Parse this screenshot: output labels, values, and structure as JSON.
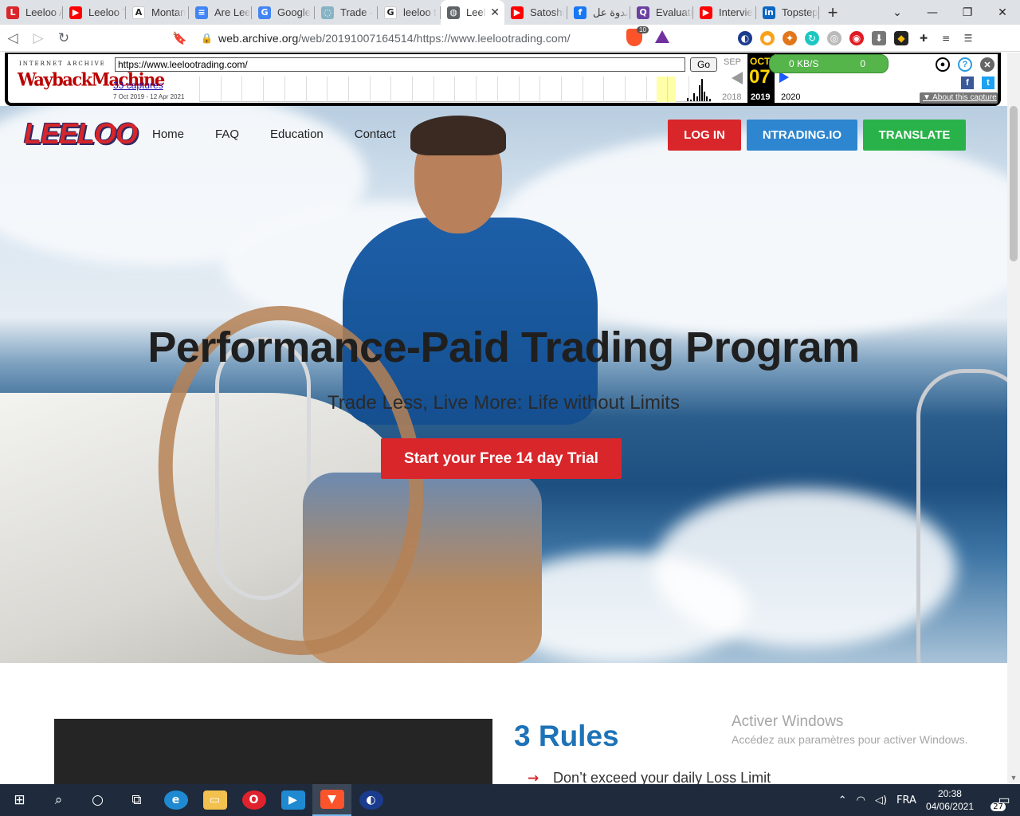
{
  "browser": {
    "tabs": [
      {
        "title": "Leeloo A",
        "icon": "leeloo-favicon",
        "color": "#d9262b",
        "glyph": "L"
      },
      {
        "title": "Leeloo T",
        "icon": "youtube-favicon",
        "color": "#ff0000",
        "glyph": "▶"
      },
      {
        "title": "Montan",
        "icon": "a-favicon",
        "color": "#ffffff",
        "glyph": "A"
      },
      {
        "title": "Are Lee",
        "icon": "google-docs-favicon",
        "color": "#4285f4",
        "glyph": "≡"
      },
      {
        "title": "Google",
        "icon": "google-translate-favicon",
        "color": "#4285f4",
        "glyph": "G"
      },
      {
        "title": "Trade -",
        "icon": "loading-favicon",
        "color": "#86b4c4",
        "glyph": "◌"
      },
      {
        "title": "leeloo t",
        "icon": "google-favicon",
        "color": "#ffffff",
        "glyph": "G"
      },
      {
        "title": "Leel",
        "icon": "globe-favicon",
        "color": "#5f6368",
        "glyph": "◍",
        "active": true
      },
      {
        "title": "Satoshi",
        "icon": "youtube-favicon",
        "color": "#ff0000",
        "glyph": "▶"
      },
      {
        "title": "ندوة عل",
        "icon": "facebook-favicon",
        "color": "#1877f2",
        "glyph": "f"
      },
      {
        "title": "Evaluati",
        "icon": "q-favicon",
        "color": "#6b3fa0",
        "glyph": "Q"
      },
      {
        "title": "Intervie",
        "icon": "youtube-favicon",
        "color": "#ff0000",
        "glyph": "▶"
      },
      {
        "title": "Topstep",
        "icon": "linkedin-favicon",
        "color": "#0a66c2",
        "glyph": "in"
      }
    ],
    "url_main": "web.archive.org",
    "url_rest": "/web/20191007164514/https://www.leelootrading.com/",
    "brave_badge": "10"
  },
  "wayback": {
    "logo_top": "INTERNET ARCHIVE",
    "logo": "WaybackMachine",
    "url_value": "https://www.leelootrading.com/",
    "go_label": "Go",
    "captures": "33 captures",
    "range": "7 Oct 2019 - 12 Apr 2021",
    "prev_month": "SEP",
    "cur_month": "OCT",
    "day": "07",
    "prev_year": "2018",
    "cur_year": "2019",
    "next_year": "2020",
    "speed": "0 KB/S",
    "count": "0",
    "about": "About this capture"
  },
  "site": {
    "logo": "LEELOO",
    "nav": [
      "Home",
      "FAQ",
      "Education",
      "Contact"
    ],
    "login": "LOG IN",
    "ntrading": "NTRADING.IO",
    "translate": "TRANSLATE",
    "hero_title": "Performance-Paid Trading Program",
    "hero_subtitle": "Trade Less, Live More: Life without Limits",
    "hero_button": "Start your Free 14 day Trial",
    "rules_title": "3 Rules",
    "rule_1": "Don’t exceed your daily Loss Limit",
    "activate_title": "Activer Windows",
    "activate_sub": "Accédez aux paramètres pour activer Windows."
  },
  "taskbar": {
    "lang": "FRA",
    "time": "20:38",
    "date": "04/06/2021",
    "notifications": "27"
  }
}
